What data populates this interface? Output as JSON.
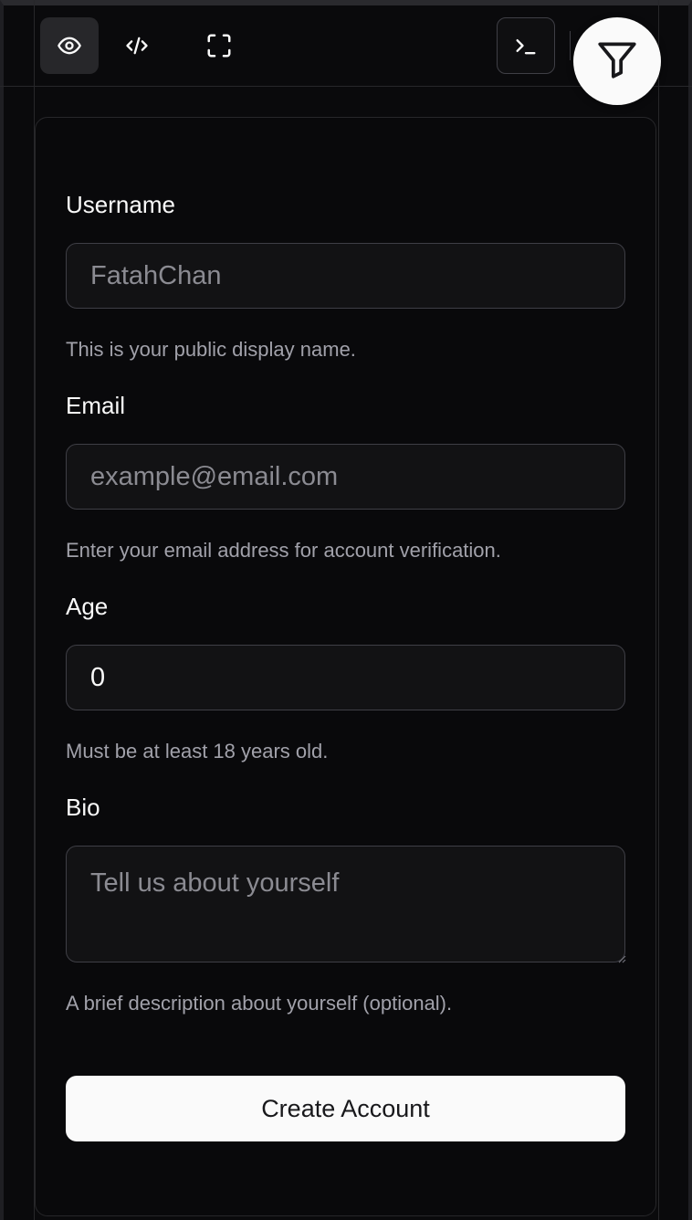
{
  "toolbar": {
    "icons": [
      "eye-icon",
      "code-icon",
      "fullscreen-icon",
      "terminal-icon",
      "filter-icon"
    ]
  },
  "form": {
    "username": {
      "label": "Username",
      "placeholder": "FatahChan",
      "help": "This is your public display name."
    },
    "email": {
      "label": "Email",
      "placeholder": "example@email.com",
      "help": "Enter your email address for account verification."
    },
    "age": {
      "label": "Age",
      "value": "0",
      "help": "Must be at least 18 years old."
    },
    "bio": {
      "label": "Bio",
      "placeholder": "Tell us about yourself",
      "help": "A brief description about yourself (optional)."
    },
    "submit_label": "Create Account"
  },
  "colors": {
    "background": "#09090b",
    "border": "#27272a",
    "input_bg": "#121214",
    "text": "#fafafa",
    "muted": "#a1a1aa",
    "button_bg": "#fafafa"
  }
}
